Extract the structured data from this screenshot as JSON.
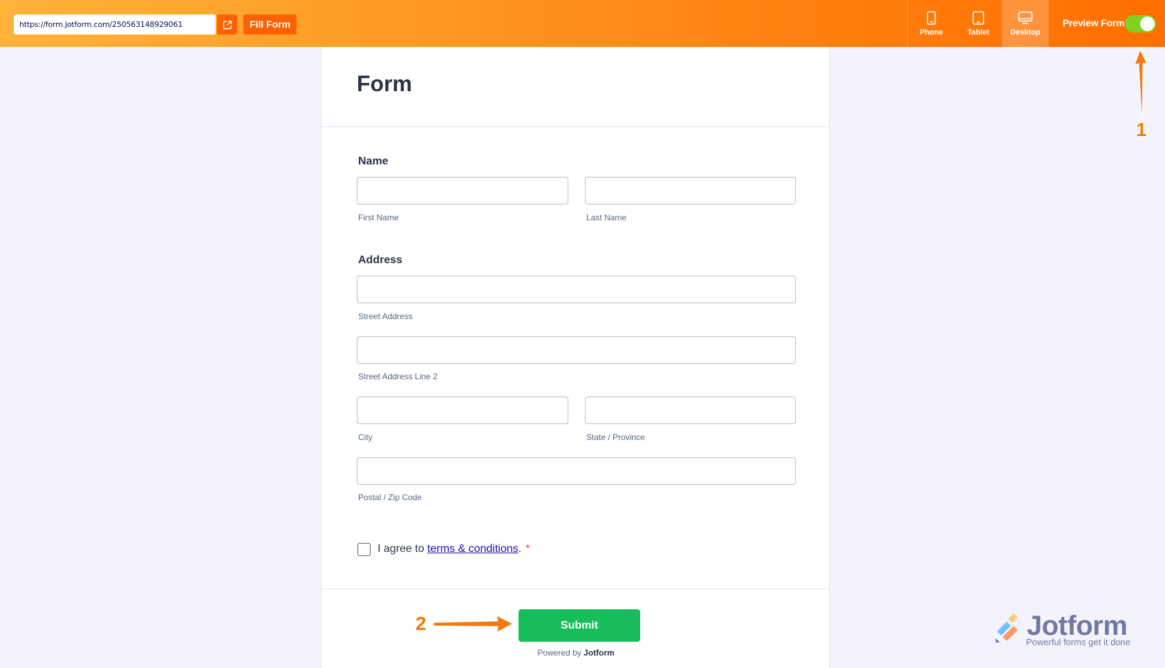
{
  "topbar": {
    "url": "https://form.jotform.com/250563148929061",
    "fill_label": "Fill Form",
    "devices": [
      {
        "label": "Phone",
        "icon": "phone-icon"
      },
      {
        "label": "Tablet",
        "icon": "tablet-icon"
      },
      {
        "label": "Desktop",
        "icon": "desktop-icon",
        "active": true
      }
    ],
    "preview_label": "Preview Form",
    "preview_on": true
  },
  "form": {
    "title": "Form",
    "name": {
      "label": "Name",
      "first_sublabel": "First Name",
      "last_sublabel": "Last Name"
    },
    "address": {
      "label": "Address",
      "street_sublabel": "Street Address",
      "street2_sublabel": "Street Address Line 2",
      "city_sublabel": "City",
      "state_sublabel": "State / Province",
      "postal_sublabel": "Postal / Zip Code"
    },
    "agree": {
      "prefix": "I agree to ",
      "link": "terms & conditions",
      "suffix": ".",
      "required_mark": "*"
    },
    "submit_label": "Submit",
    "powered_prefix": "Powered by ",
    "powered_brand": "Jotform"
  },
  "annotations": {
    "marker_1": "1",
    "marker_2": "2",
    "arrow_color": "#f07b0c"
  },
  "watermark": {
    "title": "Jotform",
    "tagline": "Powerful forms get it done"
  },
  "colors": {
    "accent": "#ff6100",
    "submit": "#18bd5b",
    "toggle_on": "#7ed321"
  }
}
